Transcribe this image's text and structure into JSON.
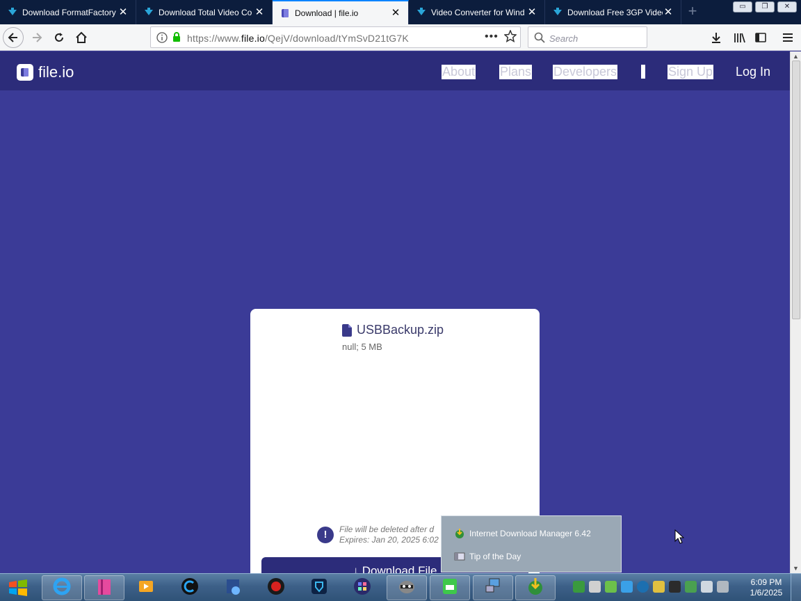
{
  "browser": {
    "tabs": [
      {
        "title": "Download FormatFactory"
      },
      {
        "title": "Download Total Video Co"
      },
      {
        "title": "Download | file.io"
      },
      {
        "title": "Video Converter for Wind"
      },
      {
        "title": "Download Free 3GP Video"
      }
    ],
    "address_bar": {
      "url_prefix": "https://www.",
      "url_domain": "file.io",
      "url_path": "/QejV/download/tYmSvD21tG7K"
    },
    "search_bar": {
      "placeholder": "Search"
    }
  },
  "site": {
    "logo_text": "file.io",
    "nav": {
      "about": "About",
      "plans": "Plans",
      "developers": "Developers",
      "sign_up": "Sign Up",
      "log_in": "Log In"
    }
  },
  "file_card": {
    "file_name": "USBBackup.zip",
    "file_meta": "null; 5 MB",
    "notice_line1": "File will be deleted after d",
    "notice_line2": "Expires: Jan 20, 2025 6:02",
    "download_button": "Download File"
  },
  "tray_popup": {
    "item1": "Internet Download Manager 6.42",
    "item2": "Tip of the Day"
  },
  "taskbar": {
    "time": "6:09 PM",
    "date": "1/6/2025"
  },
  "colors": {
    "page_bg": "#3b3b97",
    "header_bg": "#2c2c7a",
    "accent": "#0a84ff"
  }
}
